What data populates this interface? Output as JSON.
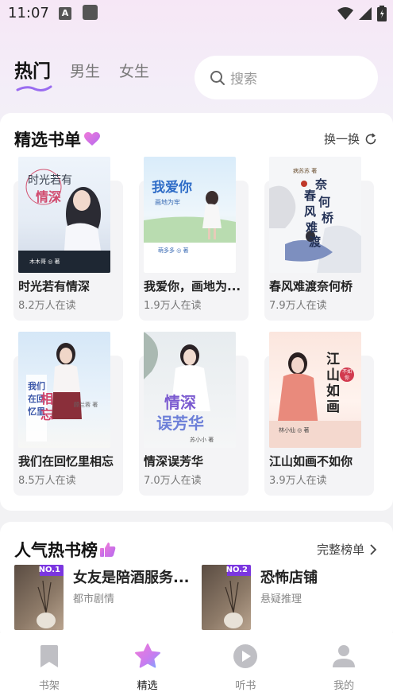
{
  "status_bar": {
    "time": "11:07",
    "a_icon_letter": "A"
  },
  "top_tabs": [
    {
      "label": "热门",
      "active": true
    },
    {
      "label": "男生",
      "active": false
    },
    {
      "label": "女生",
      "active": false
    }
  ],
  "search": {
    "placeholder": "搜索"
  },
  "featured": {
    "title": "精选书单",
    "refresh_label": "换一换",
    "books": [
      {
        "title": "时光若有情深",
        "readers": "8.2万人在读",
        "cover_text": "时光若有情深",
        "cover_author": "木木哥"
      },
      {
        "title": "我爱你，画地为...",
        "readers": "1.9万人在读",
        "cover_text": "我爱你",
        "cover_sub": "画地为牢",
        "cover_author": "萌多多"
      },
      {
        "title": "春风难渡奈何桥",
        "readers": "7.9万人在读",
        "cover_text": "春风难渡奈何桥",
        "cover_author": "病苏苏"
      },
      {
        "title": "我们在回忆里相忘",
        "readers": "8.5万人在读",
        "cover_text": "我们在回忆里相忘",
        "cover_author": "顾兰蓉"
      },
      {
        "title": "情深误芳华",
        "readers": "7.0万人在读",
        "cover_text": "情深误芳华",
        "cover_author": "苏小小"
      },
      {
        "title": "江山如画不如你",
        "readers": "3.9万人在读",
        "cover_text": "江山如画",
        "cover_sub": "不如你",
        "cover_author": "林小仙"
      }
    ]
  },
  "ranking": {
    "title": "人气热书榜",
    "full_list_label": "完整榜单",
    "items": [
      {
        "rank": "NO.1",
        "title": "女友是陪酒服务...",
        "genre": "都市剧情"
      },
      {
        "rank": "NO.2",
        "title": "恐怖店铺",
        "genre": "悬疑推理"
      }
    ]
  },
  "bottom_nav": [
    {
      "label": "书架",
      "icon": "bookmark-icon",
      "active": false
    },
    {
      "label": "精选",
      "icon": "star-icon",
      "active": true
    },
    {
      "label": "听书",
      "icon": "play-icon",
      "active": false
    },
    {
      "label": "我的",
      "icon": "person-icon",
      "active": false
    }
  ],
  "colors": {
    "accent_pink": "#e86fd4",
    "accent_blue": "#7aa8ff",
    "brand_purple": "#8a55e0"
  }
}
